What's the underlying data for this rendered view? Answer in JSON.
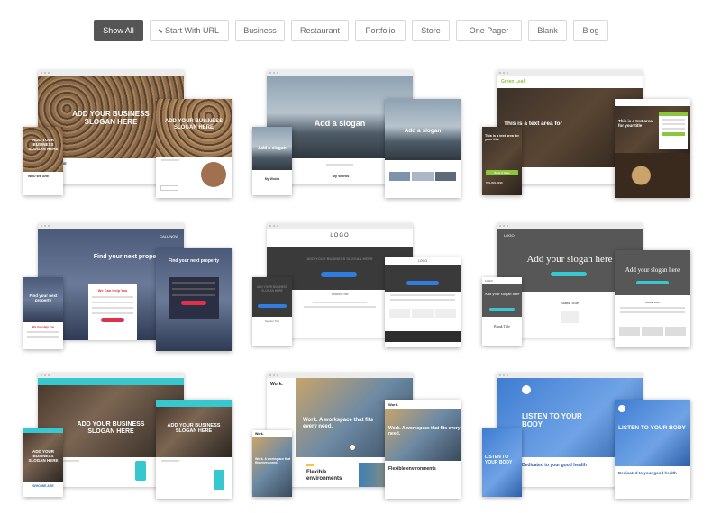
{
  "filters": [
    {
      "label": "Show All",
      "active": true
    },
    {
      "label": "Start With URL",
      "icon": "link-icon"
    },
    {
      "label": "Business"
    },
    {
      "label": "Restaurant"
    },
    {
      "label": "Portfolio"
    },
    {
      "label": "Store"
    },
    {
      "label": "One Pager"
    },
    {
      "label": "Blank"
    },
    {
      "label": "Blog"
    }
  ],
  "templates": [
    {
      "desktop_title": "ADD YOUR BUSINESS SLOGAN HERE",
      "tablet_title": "ADD YOUR BUSINESS SLOGAN HERE",
      "phone_title": "ADD YOUR BUSINESS SLOGAN HERE",
      "section": "WHO WE ARE",
      "phone_section": "WHO WE ARE"
    },
    {
      "desktop_title": "Add a slogan",
      "tablet_title": "Add a slogan",
      "phone_title": "Add a slogan",
      "section": "My Works",
      "phone_section": "My Works"
    },
    {
      "logo": "Green Leaf",
      "desktop_title": "This is a text area for title",
      "phone_title": "This is a text area for your title",
      "tablet_title": "This is a text area for your title",
      "phone_cta": "Book A Table",
      "phone_number": "599-999-9999"
    },
    {
      "desktop_title": "Find your next property",
      "tablet_title": "Find your next property",
      "phone_title": "Find your next property",
      "form_title": "We Can Help You",
      "nav": "CALL NOW"
    },
    {
      "logo": "LOGO",
      "desktop_title": "ADD YOUR BUSINESS SLOGAN HERE",
      "phone_title": "ADD YOUR BUSINESS SLOGAN HERE",
      "section": "Section Title"
    },
    {
      "logo": "LOGO",
      "desktop_title": "Add your slogan here",
      "tablet_title": "Add your slogan here",
      "phone_title": "Add your slogan here",
      "section": "Blank Title",
      "phone_section": "Blank Title"
    },
    {
      "desktop_title": "ADD YOUR BUSINESS SLOGAN HERE",
      "tablet_title": "ADD YOUR BUSINESS SLOGAN HERE",
      "phone_title": "ADD YOUR BUSINESS SLOGAN HERE",
      "section": "WHO WE ARE",
      "phone_section": "WHO WE ARE"
    },
    {
      "logo": "Work.",
      "desktop_title": "Work. A workspace that fits every need.",
      "tablet_title": "Work. A workspace that fits every need.",
      "phone_title": "Work. A workspace that fits every need.",
      "section": "Flexible environments"
    },
    {
      "desktop_title": "LISTEN TO YOUR BODY",
      "tablet_title": "LISTEN TO YOUR BODY",
      "phone_title": "LISTEN TO YOUR BODY",
      "section": "Dedicated to your good health"
    }
  ],
  "colors": {
    "active_filter": "#555555",
    "teal": "#37c7cf",
    "green": "#8cc63f",
    "red": "#e0314b",
    "blue": "#2f7de1"
  }
}
